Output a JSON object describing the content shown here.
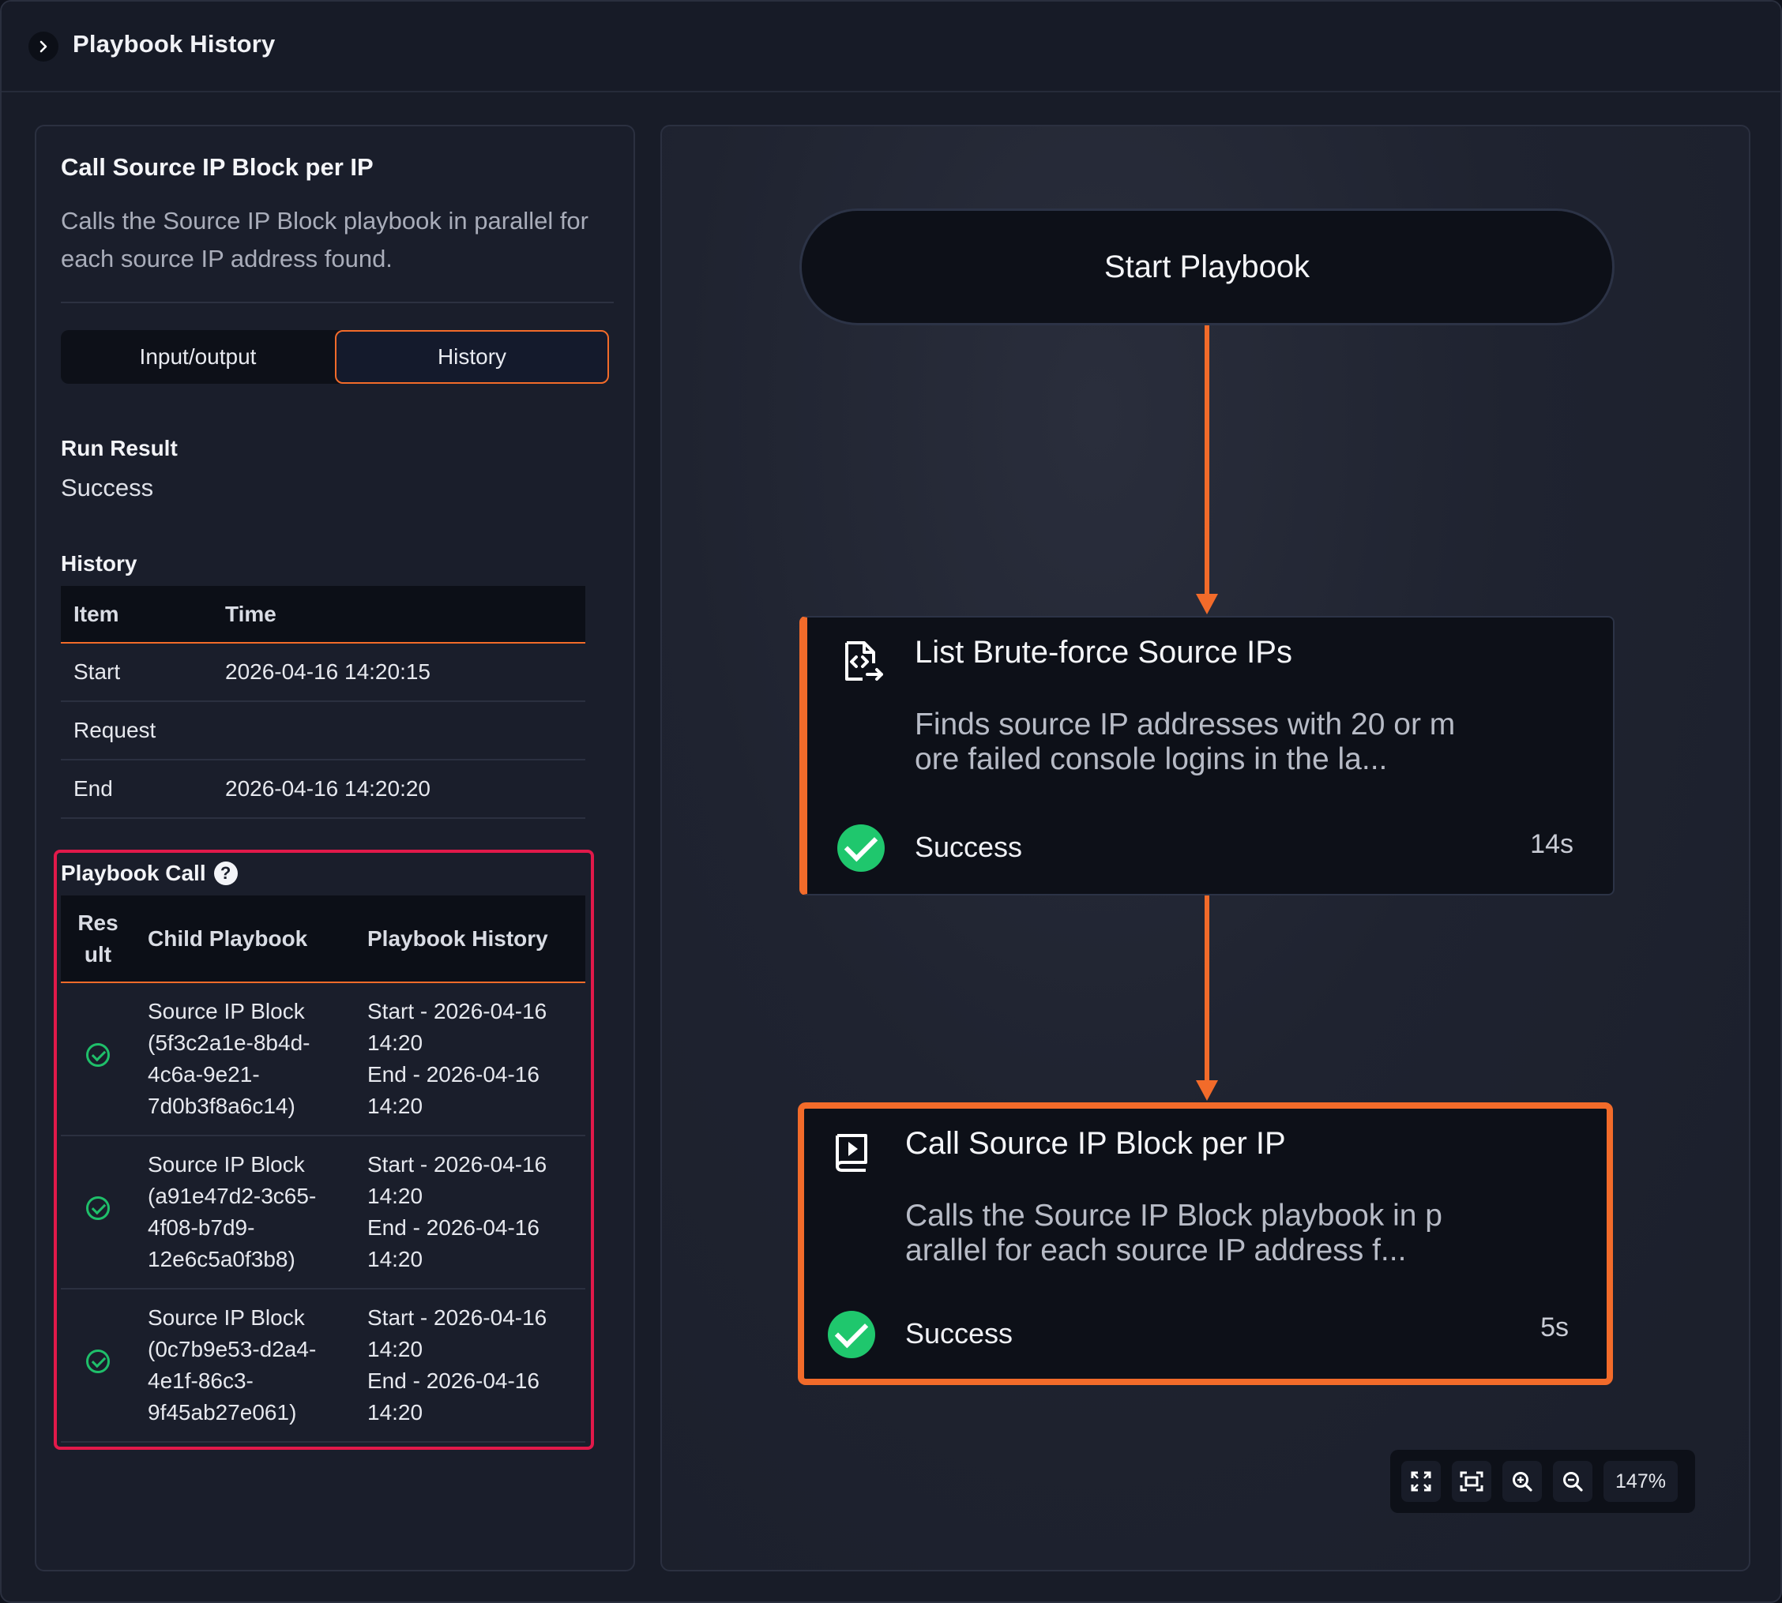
{
  "header": {
    "title": "Playbook History"
  },
  "panel": {
    "title": "Call Source IP Block per IP",
    "description": "Calls the Source IP Block playbook in parallel for each source IP address found.",
    "tabs": [
      "Input/output",
      "History"
    ],
    "active_tab": "History",
    "run_result_label": "Run Result",
    "run_result_value": "Success",
    "history_label": "History",
    "history_columns": [
      "Item",
      "Time"
    ],
    "history_rows": [
      {
        "item": "Start",
        "time": "2026-04-16 14:20:15"
      },
      {
        "item": "Request",
        "time": ""
      },
      {
        "item": "End",
        "time": "2026-04-16 14:20:20"
      }
    ],
    "playbook_call_label": "Playbook Call",
    "playbook_call_columns": [
      "Res ult",
      "Child Playbook",
      "Playbook History"
    ],
    "playbook_calls": [
      {
        "result": "success",
        "child_lines": [
          "Source IP Block",
          "(5f3c2a1e-8b4d-",
          "4c6a-9e21-",
          "7d0b3f8a6c14)"
        ],
        "history_lines": [
          "Start - 2026-04-16",
          "14:20",
          "End - 2026-04-16",
          "14:20"
        ]
      },
      {
        "result": "success",
        "child_lines": [
          "Source IP Block",
          "(a91e47d2-3c65-",
          "4f08-b7d9-",
          "12e6c5a0f3b8)"
        ],
        "history_lines": [
          "Start - 2026-04-16",
          "14:20",
          "End - 2026-04-16",
          "14:20"
        ]
      },
      {
        "result": "success",
        "child_lines": [
          "Source IP Block",
          "(0c7b9e53-d2a4-",
          "4e1f-86c3-",
          "9f45ab27e061)"
        ],
        "history_lines": [
          "Start - 2026-04-16",
          "14:20",
          "End - 2026-04-16",
          "14:20"
        ]
      }
    ]
  },
  "canvas": {
    "start_node": "Start Playbook",
    "nodes": [
      {
        "title": "List Brute-force Source IPs",
        "desc_lines": [
          "Finds source IP addresses with 20 or m",
          "ore failed console logins in the la..."
        ],
        "status": "Success",
        "duration": "14s",
        "icon": "code-file-icon"
      },
      {
        "title": "Call Source IP Block per IP",
        "desc_lines": [
          "Calls the Source IP Block playbook in p",
          "arallel for each source IP address f..."
        ],
        "status": "Success",
        "duration": "5s",
        "icon": "playbook-play-icon"
      }
    ],
    "zoom": "147%",
    "zoom_tools": [
      "fullscreen-icon",
      "fit-view-icon",
      "zoom-in-icon",
      "zoom-out-icon"
    ]
  },
  "colors": {
    "accent": "#f26b2a",
    "success": "#1fc76d",
    "highlight": "#e1194a",
    "background": "#181c28"
  }
}
